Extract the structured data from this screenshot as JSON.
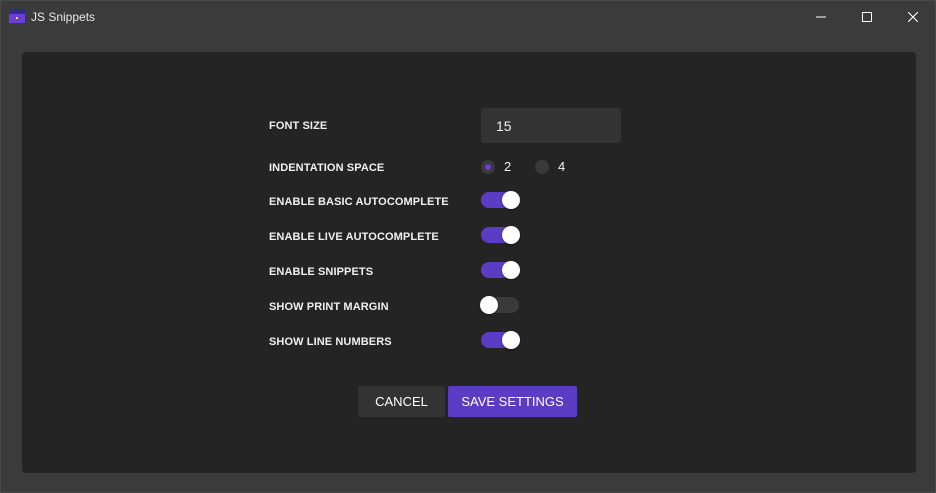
{
  "window": {
    "title": "JS Snippets",
    "accent_color": "#5b3cc4"
  },
  "settings": {
    "font_size": {
      "label": "FONT SIZE",
      "value": "15"
    },
    "indentation": {
      "label": "INDENTATION SPACE",
      "options": [
        "2",
        "4"
      ],
      "selected": "2"
    },
    "basic_autocomplete": {
      "label": "ENABLE BASIC AUTOCOMPLETE",
      "enabled": true
    },
    "live_autocomplete": {
      "label": "ENABLE LIVE AUTOCOMPLETE",
      "enabled": true
    },
    "snippets": {
      "label": "ENABLE SNIPPETS",
      "enabled": true
    },
    "print_margin": {
      "label": "SHOW PRINT MARGIN",
      "enabled": false
    },
    "line_numbers": {
      "label": "SHOW LINE NUMBERS",
      "enabled": true
    }
  },
  "buttons": {
    "cancel": "CANCEL",
    "save": "SAVE SETTINGS"
  }
}
